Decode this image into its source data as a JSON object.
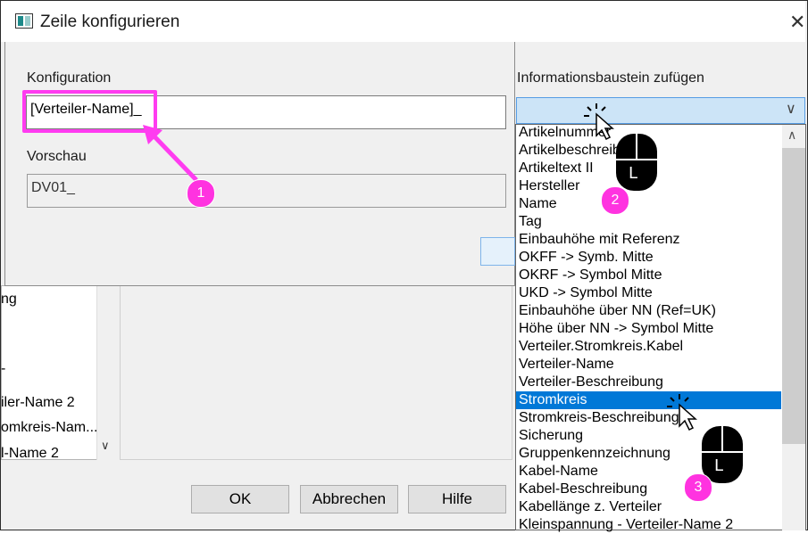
{
  "window": {
    "title": "Zeile konfigurieren",
    "close_glyph": "✕"
  },
  "config": {
    "label": "Konfiguration",
    "value": "[Verteiler-Name]_",
    "preview_label": "Vorschau",
    "preview_value": "DV01_"
  },
  "info": {
    "label": "Informationsbaustein zufügen",
    "combo_value": "",
    "items": [
      "Artikelnummer",
      "Artikelbeschreibung",
      "Artikeltext II",
      "Hersteller",
      "Name",
      "Tag",
      "Einbauhöhe mit Referenz",
      "OKFF -> Symb. Mitte",
      "OKRF -> Symbol Mitte",
      "UKD -> Symbol Mitte",
      "Einbauhöhe über NN (Ref=UK)",
      "Höhe über NN -> Symbol Mitte",
      "Verteiler.Stromkreis.Kabel",
      "Verteiler-Name",
      "Verteiler-Beschreibung",
      "Stromkreis",
      "Stromkreis-Beschreibung",
      "Sicherung",
      "Gruppenkennzeichnung",
      "Kabel-Name",
      "Kabel-Beschreibung",
      "Kabellänge z. Verteiler",
      "Kleinspannung - Verteiler-Name 2"
    ],
    "selected_index": 15
  },
  "background": {
    "list_fragments": [
      "ng",
      "-",
      "iler-Name 2",
      "omkreis-Nam...",
      "l-Name 2"
    ],
    "buttons": {
      "ok": "OK",
      "cancel": "Abbrechen",
      "help": "Hilfe"
    }
  },
  "annotations": {
    "badge1": "1",
    "badge2": "2",
    "badge3": "3",
    "mouse_letter": "L",
    "highlight_color": "#ff3cf0"
  }
}
